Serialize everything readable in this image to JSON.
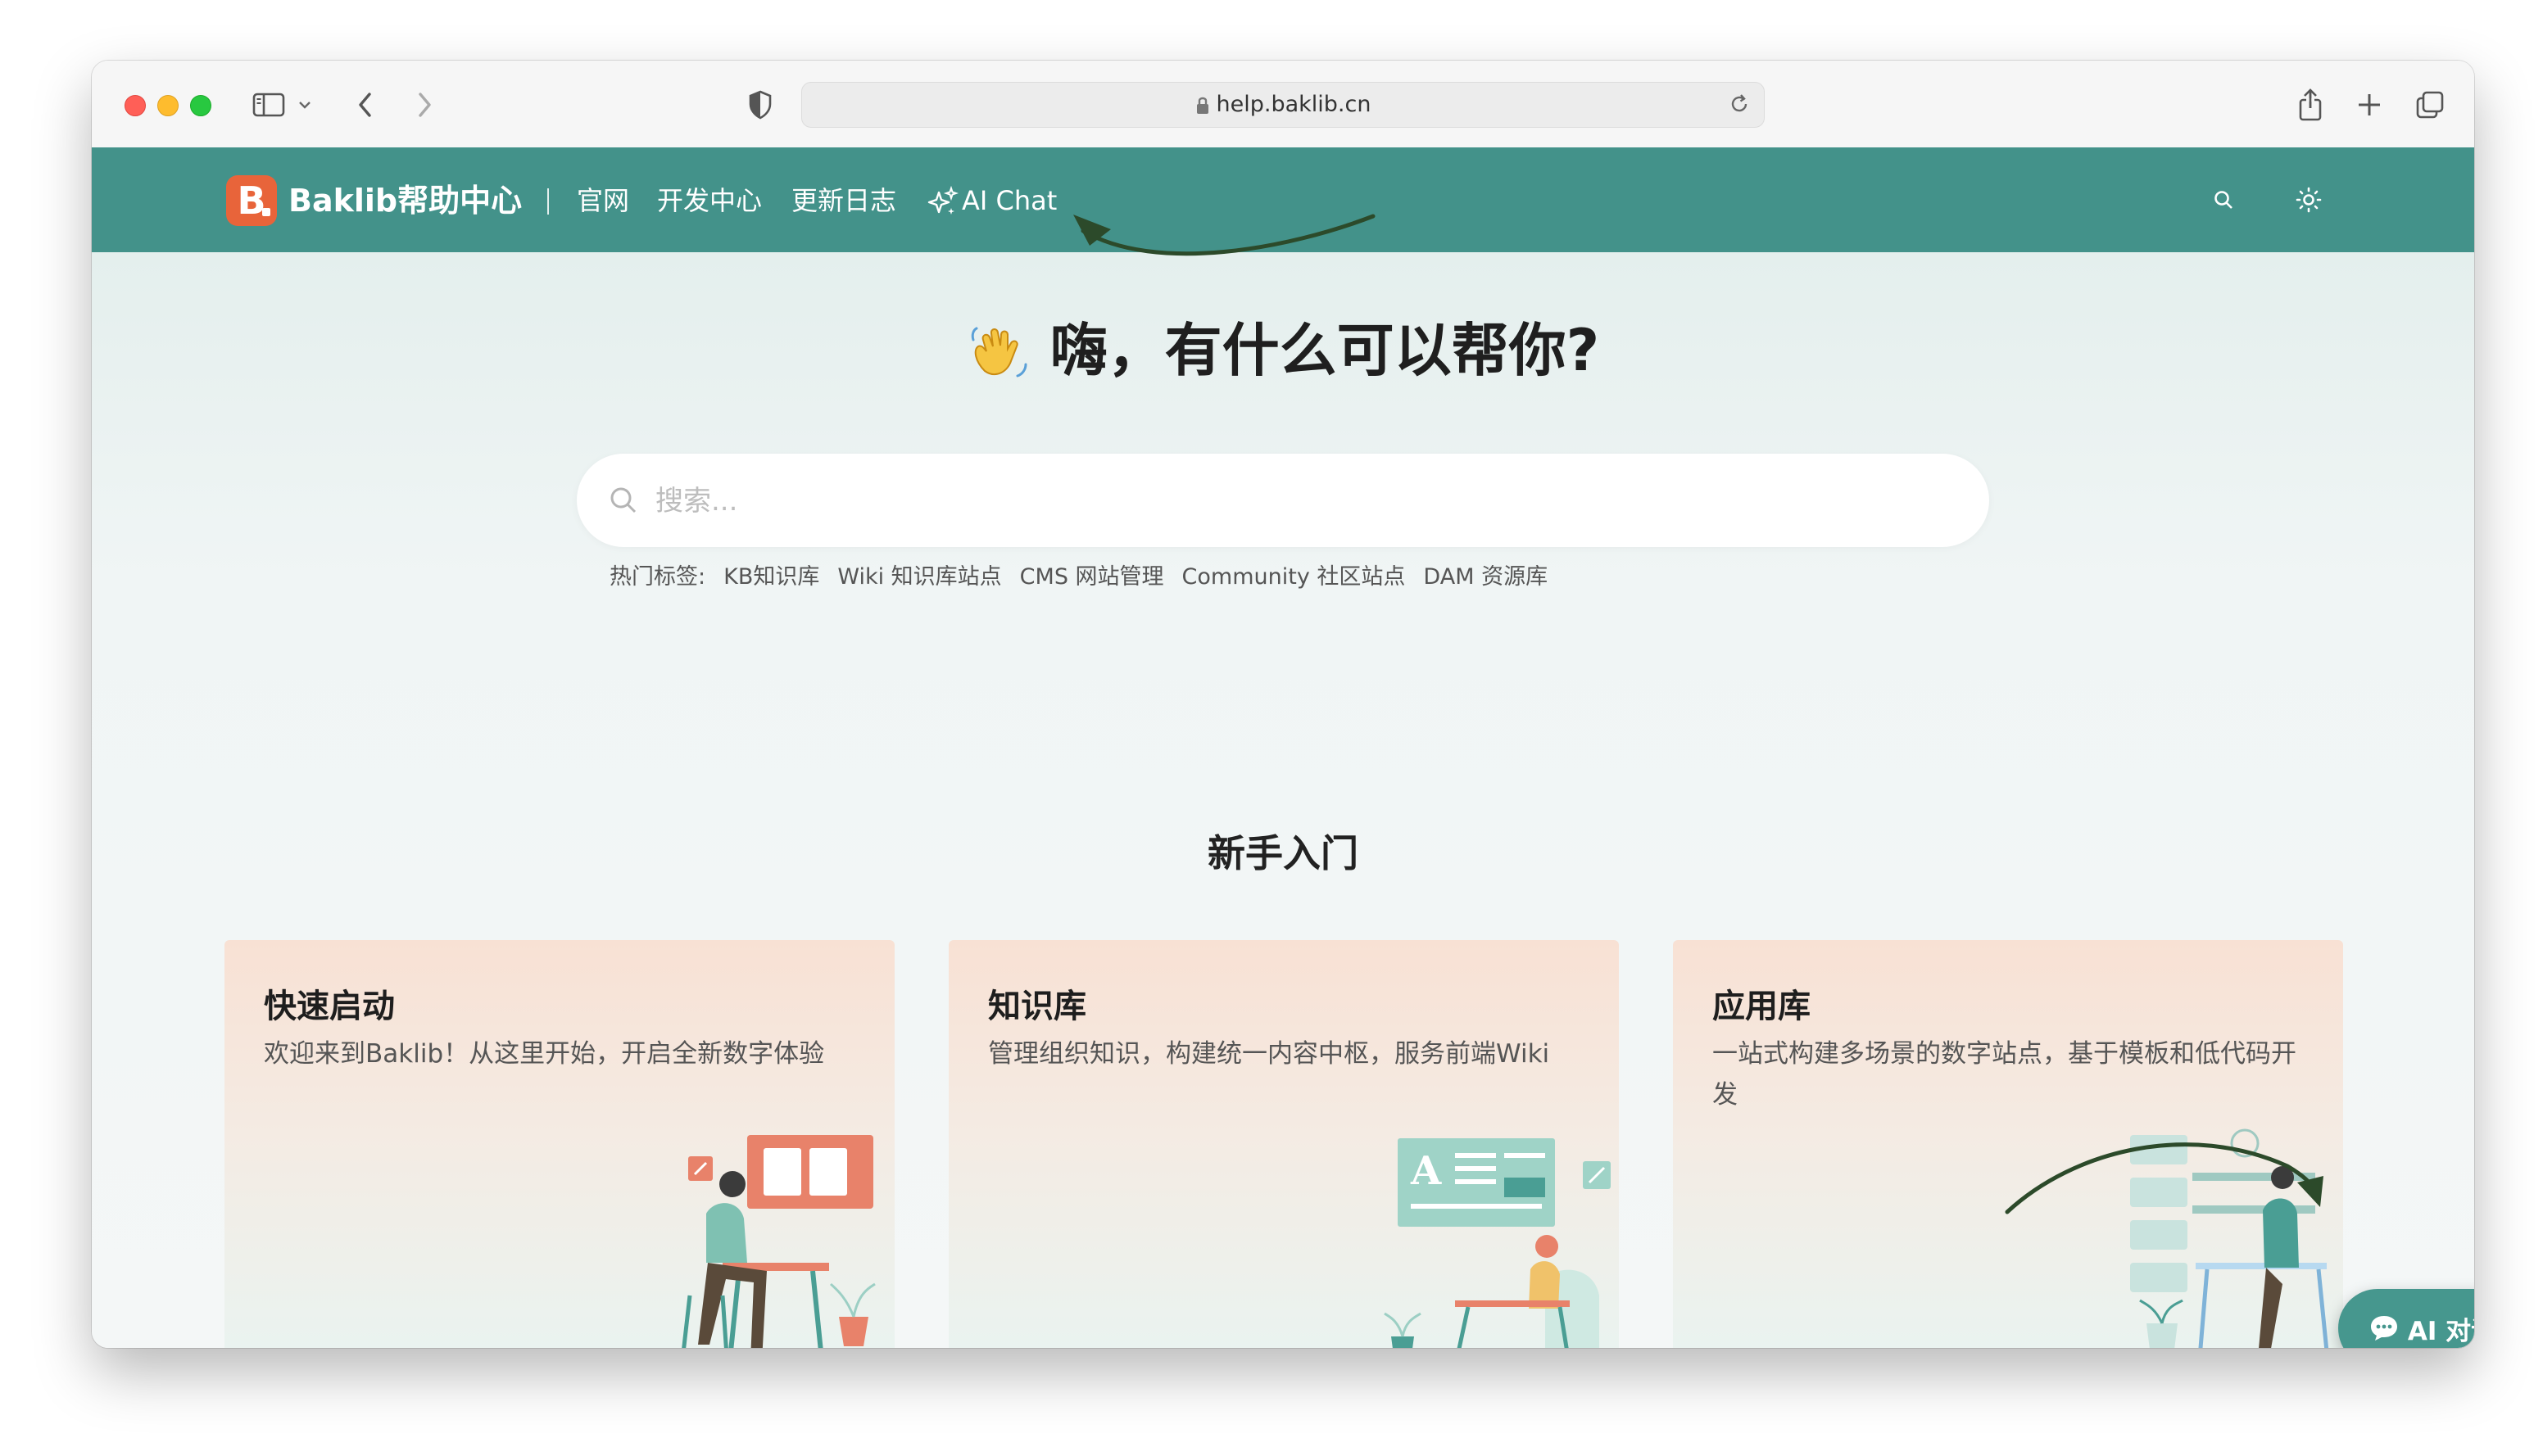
{
  "browser": {
    "url": "help.baklib.cn"
  },
  "nav": {
    "logo_letter": "B",
    "brand": "Baklib帮助中心",
    "links": [
      "官网",
      "开发中心",
      "更新日志",
      "AI Chat"
    ]
  },
  "hero": {
    "title": "嗨，有什么可以帮你?"
  },
  "search": {
    "placeholder": "搜索..."
  },
  "tags": {
    "label": "热门标签:",
    "items": [
      "KB知识库",
      "Wiki 知识库站点",
      "CMS 网站管理",
      "Community 社区站点",
      "DAM 资源库"
    ]
  },
  "section": {
    "title": "新手入门"
  },
  "cards": [
    {
      "title": "快速启动",
      "desc": "欢迎来到Baklib！从这里开始，开启全新数字体验"
    },
    {
      "title": "知识库",
      "desc": "管理组织知识，构建统一内容中枢，服务前端Wiki"
    },
    {
      "title": "应用库",
      "desc": "一站式构建多场景的数字站点，基于模板和低代码开发"
    }
  ],
  "ai_button": {
    "label": "AI 对话"
  },
  "colors": {
    "nav_bg": "#43928a",
    "logo": "#e8643a",
    "card_top": "#f8e1d4",
    "float_btn": "#46978e"
  },
  "icons": [
    "sidebar-icon",
    "chevron-down-icon",
    "back-icon",
    "forward-icon",
    "shield-icon",
    "lock-icon",
    "reload-icon",
    "share-icon",
    "plus-icon",
    "tabs-icon",
    "sparkle-icon",
    "search-icon",
    "sun-icon",
    "wave-hand-icon",
    "chat-bubble-icon"
  ]
}
